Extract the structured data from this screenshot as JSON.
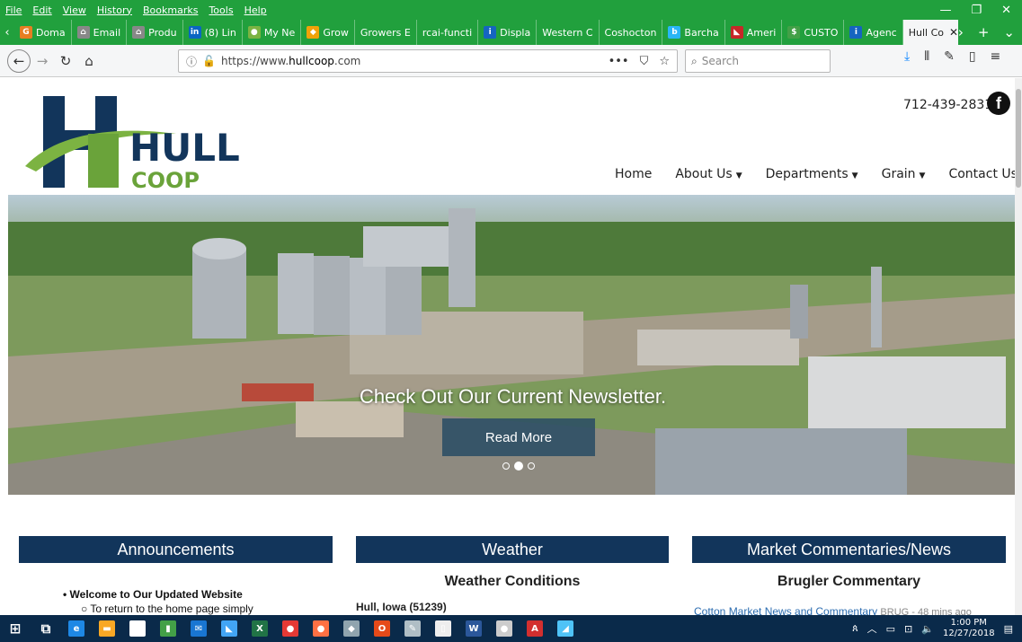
{
  "menu": [
    "File",
    "Edit",
    "View",
    "History",
    "Bookmarks",
    "Tools",
    "Help"
  ],
  "tabs": [
    {
      "label": "Doma",
      "fav_color": "#e67e22",
      "fav_glyph": "G"
    },
    {
      "label": "Email",
      "fav_color": "#888888",
      "fav_glyph": "⌂"
    },
    {
      "label": "Produ",
      "fav_color": "#888888",
      "fav_glyph": "⌂"
    },
    {
      "label": "(8) Lin",
      "fav_color": "#0a66c2",
      "fav_glyph": "in"
    },
    {
      "label": "My Ne",
      "fav_color": "#7cb342",
      "fav_glyph": "●"
    },
    {
      "label": "Grow",
      "fav_color": "#f1a208",
      "fav_glyph": "◆"
    },
    {
      "label": "Growers E",
      "fav_color": "",
      "fav_glyph": ""
    },
    {
      "label": "rcai-functi",
      "fav_color": "",
      "fav_glyph": ""
    },
    {
      "label": "Displa",
      "fav_color": "#1565c0",
      "fav_glyph": "i"
    },
    {
      "label": "Western C",
      "fav_color": "",
      "fav_glyph": ""
    },
    {
      "label": "Coshocton",
      "fav_color": "",
      "fav_glyph": ""
    },
    {
      "label": "Barcha",
      "fav_color": "#29b6f6",
      "fav_glyph": "b"
    },
    {
      "label": "Ameri",
      "fav_color": "#c62828",
      "fav_glyph": "◣"
    },
    {
      "label": "CUSTO",
      "fav_color": "#43a047",
      "fav_glyph": "$"
    },
    {
      "label": "Agenc",
      "fav_color": "#1565c0",
      "fav_glyph": "i"
    }
  ],
  "active_tab": {
    "label": "Hull Co"
  },
  "address": {
    "scheme": "https://www.",
    "host": "hullcoop",
    "tld": ".com"
  },
  "search_placeholder": "Search",
  "site": {
    "phone": "712-439-2831",
    "facebook_glyph": "f",
    "logo_main": "HULL",
    "logo_sub": "COOP",
    "nav": [
      {
        "label": "Home",
        "caret": false
      },
      {
        "label": "About Us",
        "caret": true
      },
      {
        "label": "Departments",
        "caret": true
      },
      {
        "label": "Grain",
        "caret": true
      },
      {
        "label": "Contact Us",
        "caret": false
      }
    ],
    "hero": {
      "headline": "Check Out Our Current Newsletter.",
      "button": "Read More",
      "slide_index": 1,
      "slide_count": 3
    },
    "columns": {
      "announcements": {
        "title": "Announcements",
        "item": "Welcome to Our Updated Website",
        "subitem": "To return to the home page simply"
      },
      "weather": {
        "title": "Weather",
        "subtitle": "Weather Conditions",
        "location": "Hull, Iowa (51239)"
      },
      "market": {
        "title": "Market Commentaries/News",
        "subtitle": "Brugler Commentary",
        "link": "Cotton Market News and Commentary",
        "meta": "BRUG - 48 mins ago"
      }
    }
  },
  "taskbar": {
    "time": "1:00 PM",
    "date": "12/27/2018",
    "apps": [
      {
        "name": "windows-start-icon",
        "color": "#ffffff",
        "glyph": "⊞"
      },
      {
        "name": "task-view-icon",
        "color": "#ffffff",
        "glyph": "⧉"
      },
      {
        "name": "edge-icon",
        "color": "#1e88e5",
        "glyph": "e"
      },
      {
        "name": "file-explorer-icon",
        "color": "#f9a825",
        "glyph": "▬"
      },
      {
        "name": "store-icon",
        "color": "#ffffff",
        "glyph": "⌂"
      },
      {
        "name": "files-icon",
        "color": "#43a047",
        "glyph": "▮"
      },
      {
        "name": "mail-icon",
        "color": "#1976d2",
        "glyph": "✉"
      },
      {
        "name": "app-icon",
        "color": "#42a5f5",
        "glyph": "◣"
      },
      {
        "name": "excel-icon",
        "color": "#217346",
        "glyph": "X"
      },
      {
        "name": "chrome-icon",
        "color": "#e53935",
        "glyph": "●"
      },
      {
        "name": "firefox-icon",
        "color": "#ff7043",
        "glyph": "●"
      },
      {
        "name": "app-icon",
        "color": "#90a4ae",
        "glyph": "◆"
      },
      {
        "name": "office-icon",
        "color": "#e64a19",
        "glyph": "O"
      },
      {
        "name": "app-icon",
        "color": "#b0bec5",
        "glyph": "✎"
      },
      {
        "name": "notepad-icon",
        "color": "#eeeeee",
        "glyph": "▯"
      },
      {
        "name": "word-icon",
        "color": "#2b579a",
        "glyph": "W"
      },
      {
        "name": "app-icon",
        "color": "#cccccc",
        "glyph": "●"
      },
      {
        "name": "acrobat-icon",
        "color": "#d32f2f",
        "glyph": "A"
      },
      {
        "name": "app-icon",
        "color": "#4fc3f7",
        "glyph": "◢"
      }
    ]
  }
}
